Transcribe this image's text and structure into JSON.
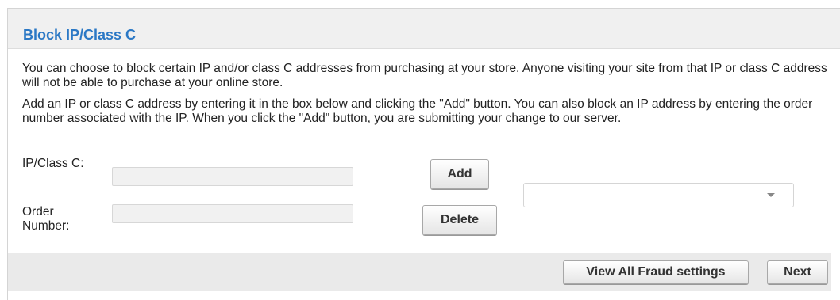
{
  "section": {
    "title": "Block IP/Class C"
  },
  "description": {
    "paragraph1": "You can choose to block certain IP and/or class C addresses from purchasing at your store. Anyone visiting your site from that IP or class C address will not be able to purchase at your online store.",
    "paragraph2": "Add an IP or class C address by entering it in the box below and clicking the \"Add\" button. You can also block an IP address by entering the order number associated with the IP. When you click the \"Add\" button, you are submitting your change to our server."
  },
  "form": {
    "ip_label": "IP/Class C:",
    "ip_value": "",
    "order_label": "Order Number:",
    "order_value": "",
    "add_label": "Add",
    "delete_label": "Delete",
    "blocked_list_selected": ""
  },
  "footer": {
    "view_fraud_label": "View All Fraud settings",
    "next_label": "Next"
  },
  "colors": {
    "title": "#2b78c5",
    "header_bg": "#f0f0f0",
    "footer_bg": "#eaeaea"
  },
  "icons": {
    "dropdown": "caret-down-icon"
  }
}
